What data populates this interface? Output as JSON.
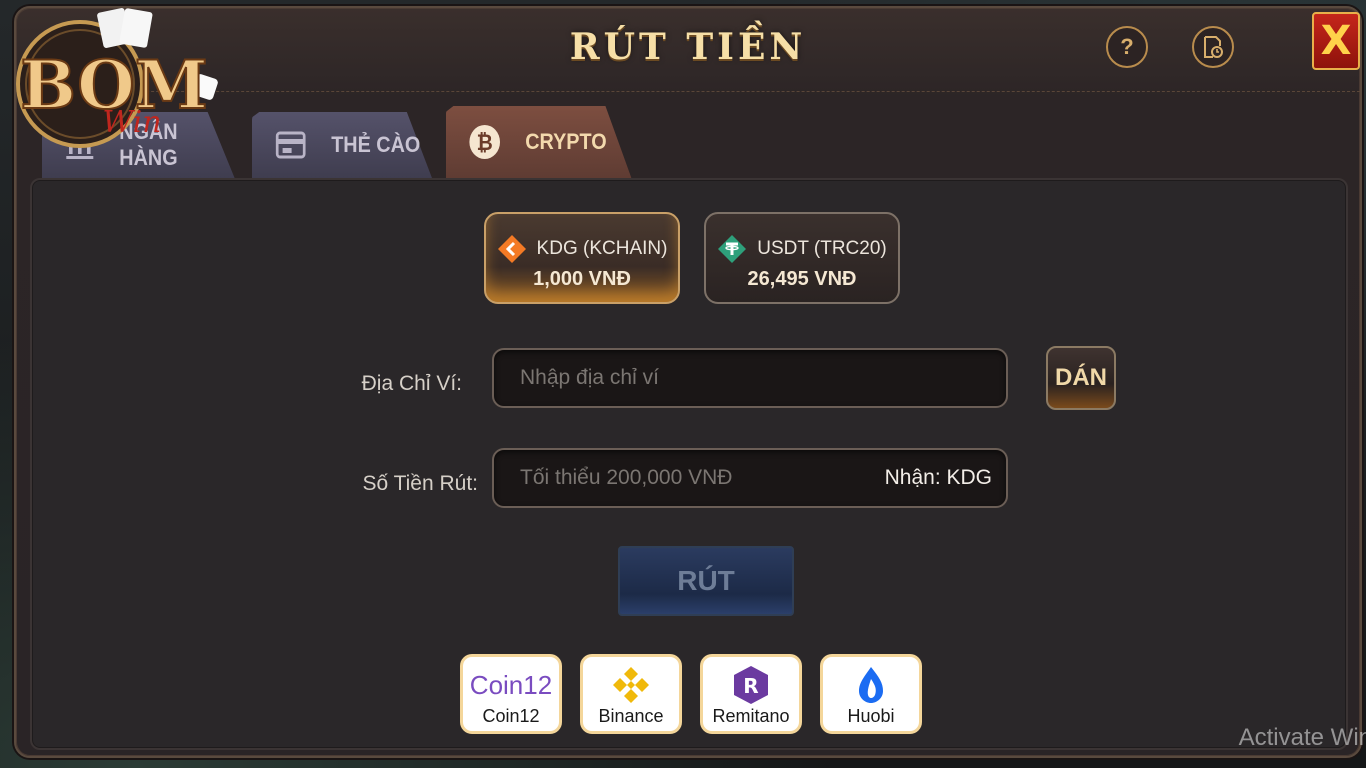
{
  "header": {
    "title": "RÚT TIỀN",
    "help_label": "?",
    "close_label": "X"
  },
  "logo": {
    "text_main": "BOM",
    "text_sub": "Win"
  },
  "tabs": [
    {
      "label": "NGÂN HÀNG",
      "active": false
    },
    {
      "label": "THẺ CÀO",
      "active": false
    },
    {
      "label": "CRYPTO",
      "active": true
    }
  ],
  "coins": [
    {
      "name": "KDG (KCHAIN)",
      "rate": "1,000 VNĐ",
      "icon": "kdg-icon",
      "active": true,
      "color": "#f47a25"
    },
    {
      "name": "USDT (TRC20)",
      "rate": "26,495 VNĐ",
      "icon": "tether-icon",
      "active": false,
      "color": "#2ea07b"
    }
  ],
  "form": {
    "wallet_label": "Địa Chỉ Ví:",
    "wallet_placeholder": "Nhập địa chỉ ví",
    "paste_label": "DÁN",
    "amount_label": "Số Tiền Rút:",
    "amount_placeholder": "Tối thiểu 200,000 VNĐ",
    "amount_suffix": "Nhận: KDG",
    "submit_label": "RÚT"
  },
  "exchanges": [
    {
      "name": "Coin12",
      "logo_text": "Coin12",
      "icon": "coin12-icon"
    },
    {
      "name": "Binance",
      "icon": "binance-icon",
      "color": "#f0b90b"
    },
    {
      "name": "Remitano",
      "icon": "remitano-icon",
      "color": "#6b3aa0"
    },
    {
      "name": "Huobi",
      "icon": "huobi-icon",
      "color": "#1b6cf2"
    }
  ],
  "watermark": "Activate Win"
}
